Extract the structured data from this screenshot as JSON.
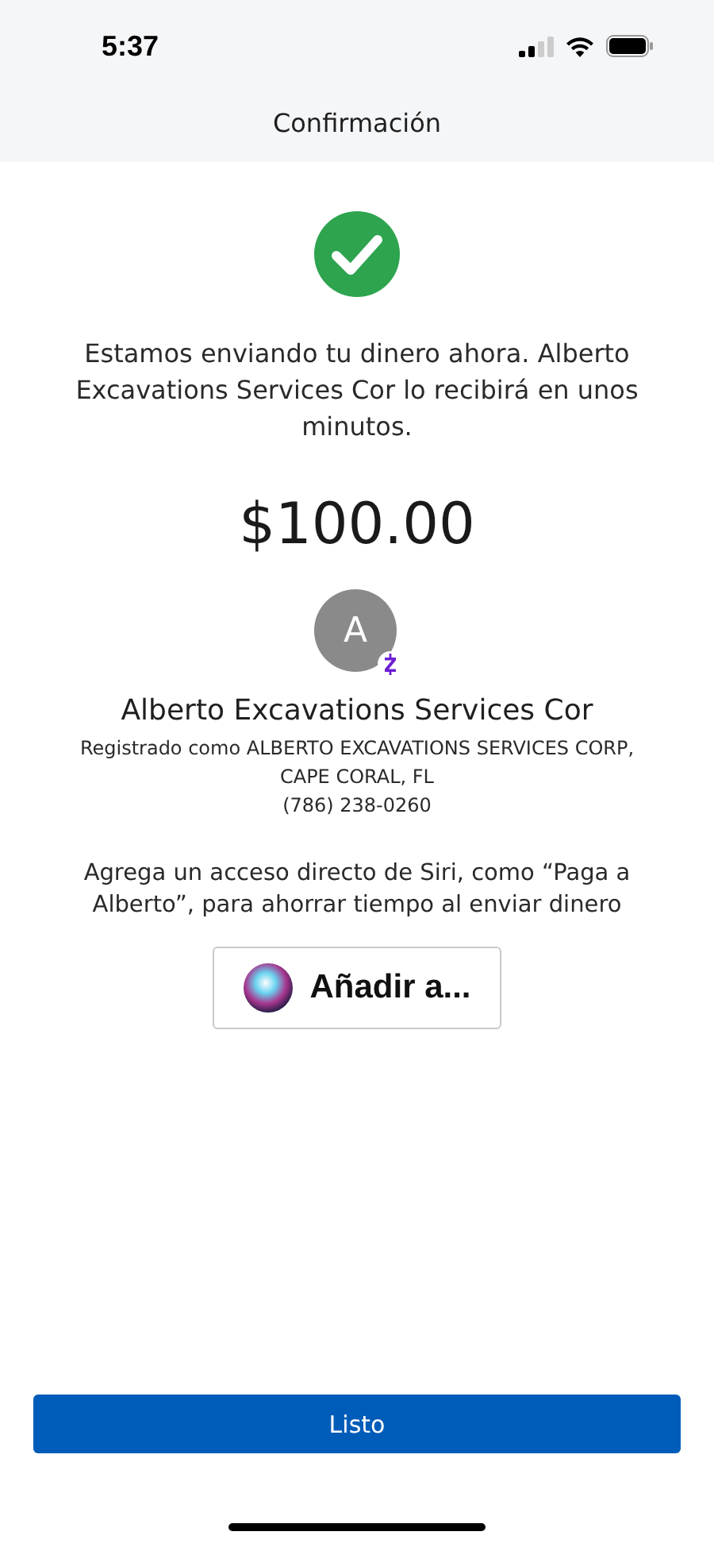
{
  "status_bar": {
    "time": "5:37"
  },
  "nav": {
    "title": "Confirmación"
  },
  "message": "Estamos enviando tu dinero ahora. Alberto Excavations Services Cor lo recibirá en unos minutos.",
  "amount": "$100.00",
  "recipient": {
    "initial": "A",
    "name": "Alberto Excavations Services Cor",
    "registered_lines": [
      "Registrado como ALBERTO EXCAVATIONS SERVICES CORP,",
      "CAPE CORAL, FL"
    ],
    "phone": "(786) 238-0260"
  },
  "siri": {
    "text": "Agrega un acceso directo de Siri, como “Paga a Alberto”, para ahorrar tiempo al enviar dinero",
    "button": "Añadir a..."
  },
  "done_button": "Listo"
}
